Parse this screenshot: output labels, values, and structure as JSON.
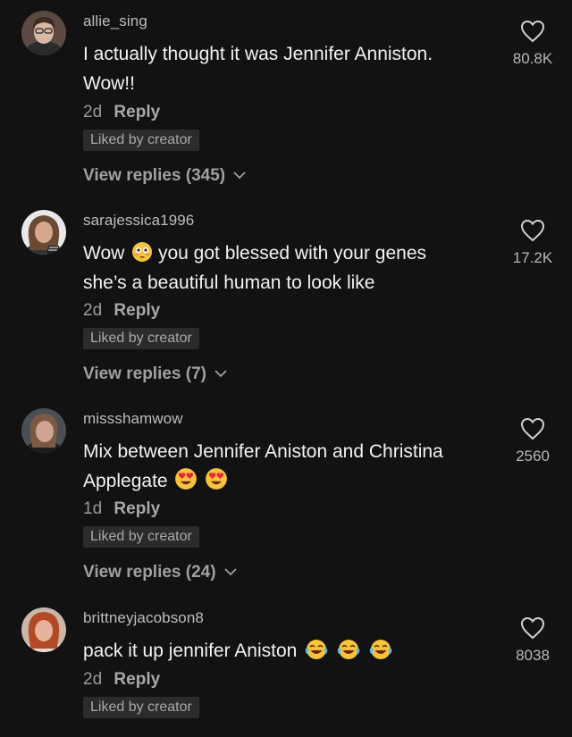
{
  "comments": [
    {
      "username": "allie_sing",
      "text_line1": "I actually thought it was Jennifer Anniston.",
      "text_line2": "Wow!!",
      "age": "2d",
      "reply_label": "Reply",
      "liked_badge": "Liked by creator",
      "view_replies": "View replies (345)",
      "like_count": "80.8K"
    },
    {
      "username": "sarajessica1996",
      "text_line1_a": "Wow",
      "text_line1_b": "you got blessed with your genes",
      "text_line2": "she’s a beautiful human to look like",
      "age": "2d",
      "reply_label": "Reply",
      "liked_badge": "Liked by creator",
      "view_replies": "View replies (7)",
      "like_count": "17.2K"
    },
    {
      "username": "missshamwow",
      "text_line1": "Mix between Jennifer Aniston and Christina",
      "text_line2": "Applegate",
      "age": "1d",
      "reply_label": "Reply",
      "liked_badge": "Liked by creator",
      "view_replies": "View replies (24)",
      "like_count": "2560"
    },
    {
      "username": "brittneyjacobson8",
      "text_line1": "pack it up jennifer Aniston",
      "age": "2d",
      "reply_label": "Reply",
      "liked_badge": "Liked by creator",
      "like_count": "8038"
    }
  ],
  "icons": {
    "like": "heart-outline-icon",
    "chevron": "chevron-down-icon",
    "emoji_flushed": "flushed-face-emoji",
    "emoji_heart_eyes": "heart-eyes-emoji",
    "emoji_laughing": "tears-of-joy-emoji"
  },
  "colors": {
    "background": "#121212",
    "badge_bg": "#2b2b2b",
    "muted_text": "#9a9a9a"
  }
}
